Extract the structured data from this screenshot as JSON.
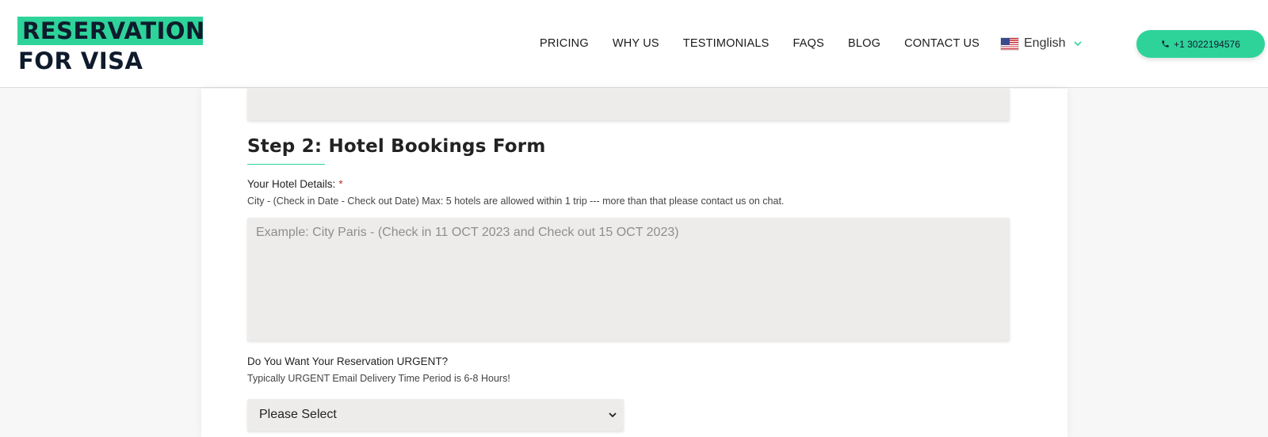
{
  "logo": {
    "line1": "RESERVATION",
    "line2": "FOR VISA",
    "accent_color": "#2ed39a"
  },
  "nav": {
    "items": [
      "PRICING",
      "WHY US",
      "TESTIMONIALS",
      "FAQS",
      "BLOG",
      "CONTACT US"
    ]
  },
  "language": {
    "label": "English",
    "flag_icon": "us-flag-icon",
    "chevron_icon": "chevron-down-icon"
  },
  "phone_button": {
    "label": "+1 3022194576",
    "icon": "phone-icon"
  },
  "form": {
    "step_title": "Step 2: Hotel Bookings Form",
    "hotel_details": {
      "label": "Your Hotel Details:",
      "required_mark": "*",
      "help": "City - (Check in Date - Check out Date) Max: 5 hotels are allowed within 1 trip --- more than that please contact us on chat.",
      "placeholder": "Example: City Paris - (Check in 11 OCT 2023 and Check out 15 OCT 2023)",
      "value": ""
    },
    "urgent": {
      "label": "Do You Want Your Reservation URGENT?",
      "help": "Typically URGENT Email Delivery Time Period is 6-8 Hours!",
      "selected": "Please Select"
    }
  },
  "colors": {
    "accent": "#2ed39a",
    "field_bg": "#edeceb",
    "required": "#b83232"
  }
}
